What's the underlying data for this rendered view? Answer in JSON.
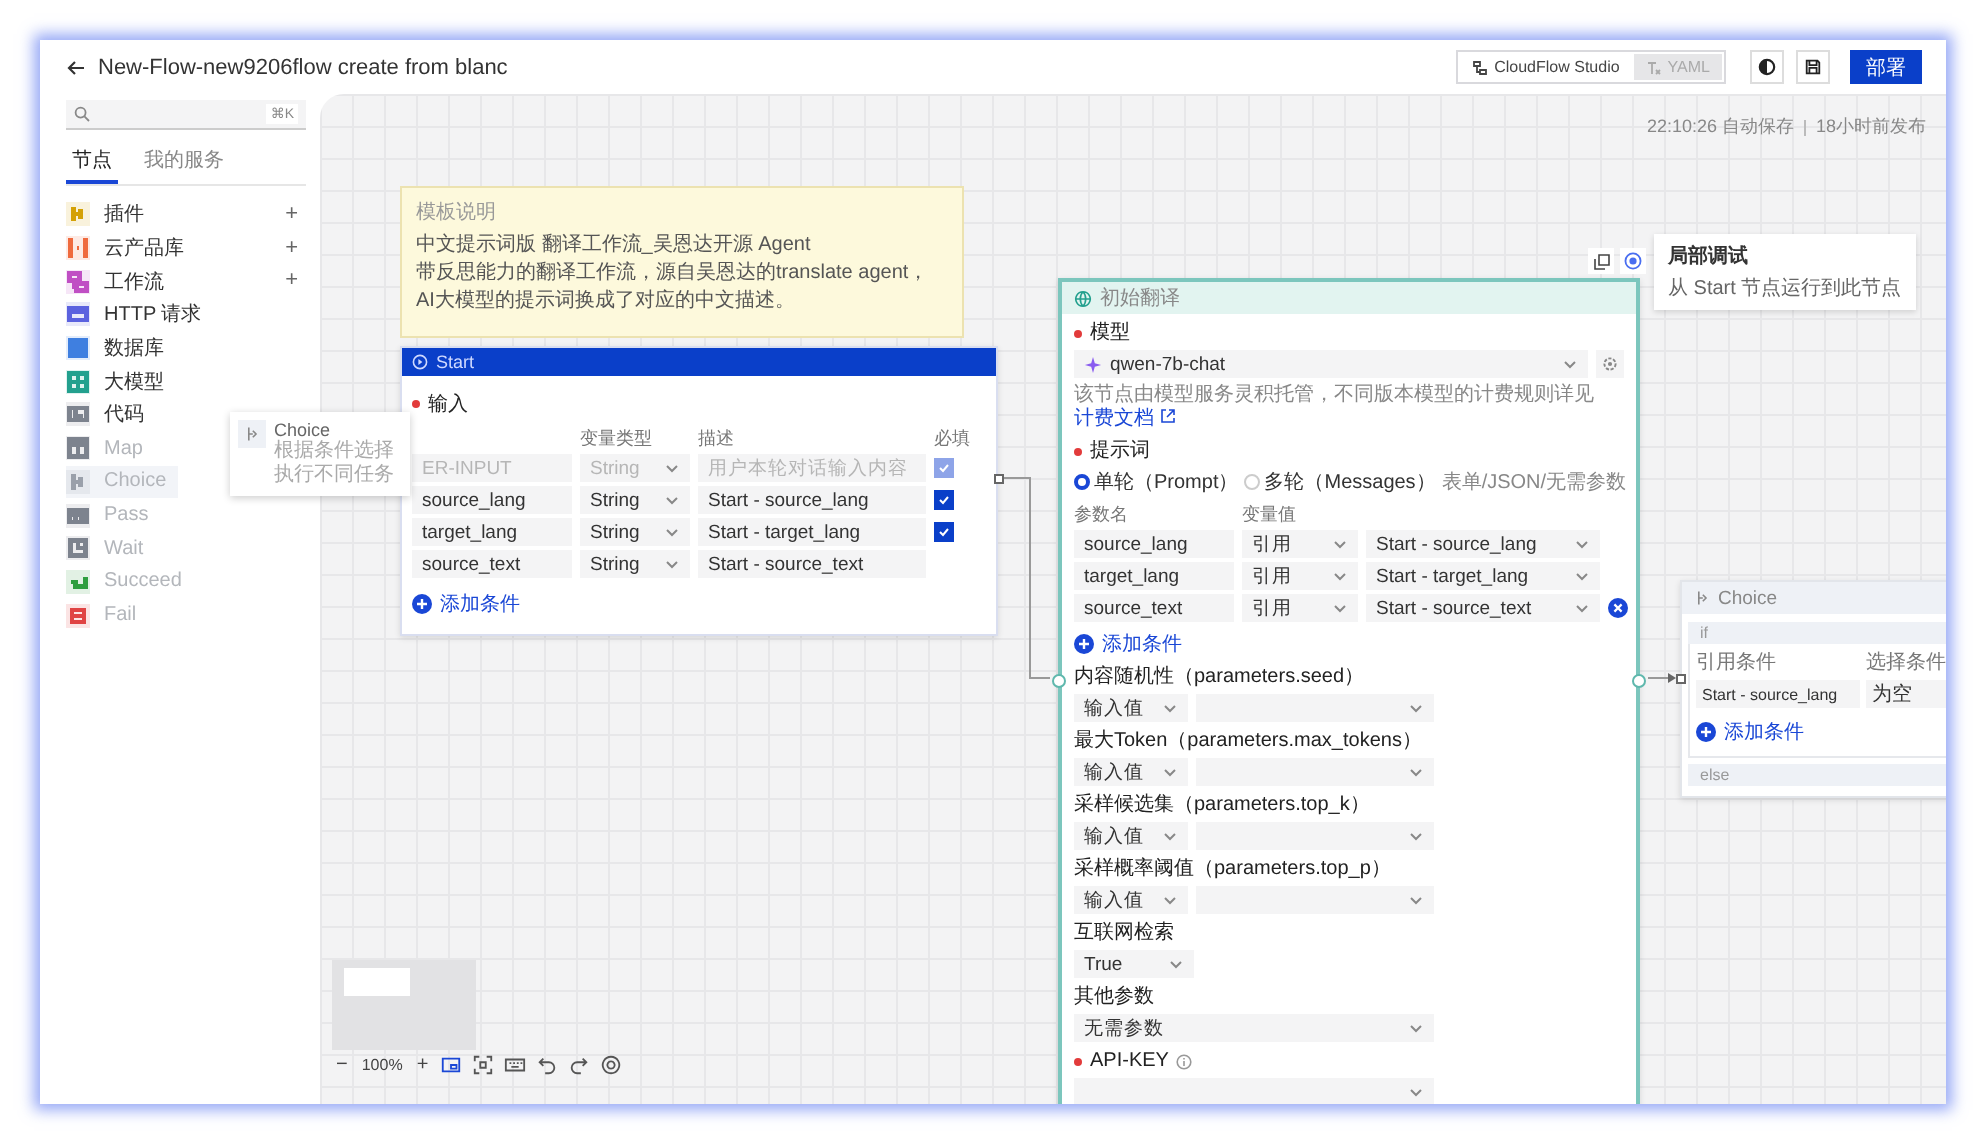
{
  "window": {
    "title": "New-Flow-new9206flow create from blanc"
  },
  "header": {
    "view_switch": [
      {
        "label": "CloudFlow Studio",
        "selected": true
      },
      {
        "label": "YAML",
        "selected": false
      }
    ],
    "deploy_button": "部署"
  },
  "sidebar": {
    "search": {
      "shortcut": "⌘K"
    },
    "tabs": [
      {
        "label": "节点",
        "selected": true
      },
      {
        "label": "我的服务",
        "selected": false
      }
    ],
    "items": [
      {
        "label": "插件",
        "color": "#d4a106",
        "add": "+",
        "selected": false,
        "disabled": false
      },
      {
        "label": "云产品库",
        "color": "#ef6a3e",
        "add": "+",
        "selected": false,
        "disabled": false
      },
      {
        "label": "工作流",
        "color": "#c04fc4",
        "add": "+",
        "selected": false,
        "disabled": false
      },
      {
        "label": "HTTP 请求",
        "color": "#5b62df",
        "selected": false,
        "disabled": false
      },
      {
        "label": "数据库",
        "color": "#3f7fe0",
        "selected": false,
        "disabled": false
      },
      {
        "label": "大模型",
        "color": "#23a08e",
        "selected": false,
        "disabled": false
      },
      {
        "label": "代码",
        "color": "#7d838e",
        "selected": false,
        "disabled": false
      },
      {
        "label": "Map",
        "color": "#7d838e",
        "selected": false,
        "disabled": true
      },
      {
        "label": "Choice",
        "color": "#9aa0aa",
        "selected": true,
        "disabled": true
      },
      {
        "label": "Pass",
        "color": "#7d838e",
        "selected": false,
        "disabled": true
      },
      {
        "label": "Wait",
        "color": "#7d838e",
        "selected": false,
        "disabled": true
      },
      {
        "label": "Succeed",
        "color": "#2f9e3f",
        "selected": false,
        "disabled": true
      },
      {
        "label": "Fail",
        "color": "#e04343",
        "selected": false,
        "disabled": true
      }
    ]
  },
  "drag_preview": {
    "title": "Choice",
    "subtitle": "根据条件选择执行不同任务"
  },
  "canvas": {
    "save_status": "22:10:26 自动保存",
    "publish_status": "18小时前发布",
    "note": {
      "title": "模板说明",
      "lines": [
        "中文提示词版 翻译工作流_吴恩达开源 Agent",
        "带反思能力的翻译工作流，源自吴恩达的translate agent，",
        "AI大模型的提示词换成了对应的中文描述。"
      ]
    },
    "start_node": {
      "title": "Start",
      "section": {
        "label": "输入",
        "required": true
      },
      "columns": [
        "变量类型",
        "描述",
        "必填"
      ],
      "rows": [
        {
          "name": "ER-INPUT",
          "type": "String",
          "description": "用户本轮对话输入内容",
          "disabled": true,
          "required": true
        },
        {
          "name": "source_lang",
          "type": "String",
          "description": "Start - source_lang",
          "disabled": false,
          "required": true
        },
        {
          "name": "target_lang",
          "type": "String",
          "description": "Start - target_lang",
          "disabled": false,
          "required": true
        },
        {
          "name": "source_text",
          "type": "String",
          "description": "Start - source_text",
          "disabled": false,
          "required": false
        }
      ],
      "add_label": "添加条件"
    },
    "model_node": {
      "title": "初始翻译",
      "model": {
        "label": "模型",
        "required": true,
        "value": "qwen-7b-chat"
      },
      "hint": "该节点由模型服务灵积托管，不同版本模型的计费规则详见",
      "doc_link": "计费文档",
      "prompt": {
        "label": "提示词",
        "required": true
      },
      "prompt_modes": [
        {
          "label": "单轮（Prompt）",
          "selected": true
        },
        {
          "label": "多轮（Messages）",
          "selected": false
        }
      ],
      "prompt_note": "表单/JSON/无需参数",
      "param_headers": [
        "参数名",
        "变量值"
      ],
      "params": [
        {
          "name": "source_lang",
          "mode": "引用",
          "value": "Start - source_lang",
          "removable": false
        },
        {
          "name": "target_lang",
          "mode": "引用",
          "value": "Start - target_lang",
          "removable": false
        },
        {
          "name": "source_text",
          "mode": "引用",
          "value": "Start - source_text",
          "removable": true
        }
      ],
      "add_label": "添加条件",
      "settings": [
        {
          "kind": "pair",
          "label": "内容随机性（parameters.seed）",
          "mode": "输入值"
        },
        {
          "kind": "pair",
          "label": "最大Token（parameters.max_tokens）",
          "mode": "输入值"
        },
        {
          "kind": "pair",
          "label": "采样候选集（parameters.top_k）",
          "mode": "输入值"
        },
        {
          "kind": "pair",
          "label": "采样概率阈值（parameters.top_p）",
          "mode": "输入值"
        },
        {
          "kind": "short",
          "label": "互联网检索",
          "value": "True"
        },
        {
          "kind": "wide",
          "label": "其他参数",
          "value": "无需参数"
        },
        {
          "kind": "wide",
          "label": "API-KEY",
          "required": true,
          "info": true
        }
      ]
    },
    "tooltip": {
      "title": "局部调试",
      "text": "从 Start 节点运行到此节点"
    },
    "choice_node": {
      "title": "Choice",
      "if_label": "if",
      "columns": [
        "引用条件",
        "选择条件"
      ],
      "condition": {
        "reference": "Start - source_lang",
        "operator": "为空"
      },
      "add_label": "添加条件",
      "else_label": "else"
    },
    "zoom": {
      "out": "−",
      "value": "100%",
      "in": "+"
    },
    "tools": [
      {
        "kind": "minimap",
        "selected": true
      },
      {
        "kind": "fit",
        "selected": false
      },
      {
        "kind": "keyboard",
        "selected": false
      },
      {
        "kind": "undo",
        "selected": false
      },
      {
        "kind": "redo",
        "selected": false
      },
      {
        "kind": "target",
        "selected": false
      }
    ]
  }
}
